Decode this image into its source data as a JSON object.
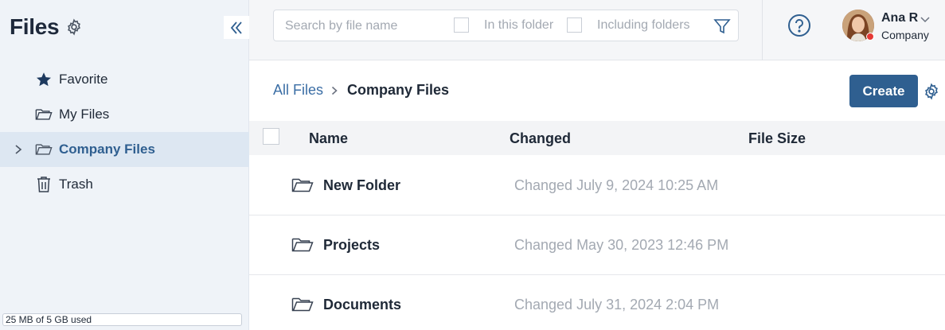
{
  "sidebar": {
    "title": "Files",
    "items": [
      {
        "label": "Favorite",
        "icon": "star-icon",
        "active": false
      },
      {
        "label": "My Files",
        "icon": "folder-icon",
        "active": false
      },
      {
        "label": "Company Files",
        "icon": "folder-icon",
        "active": true
      },
      {
        "label": "Trash",
        "icon": "trash-icon",
        "active": false
      }
    ],
    "storage_text": "25 MB of 5 GB used"
  },
  "search": {
    "placeholder": "Search by file name",
    "option_in_folder": "In this folder",
    "option_including_folders": "Including folders"
  },
  "user": {
    "name": "Ana R",
    "company": "Company",
    "status_color": "#e53935"
  },
  "breadcrumb": {
    "root": "All Files",
    "current": "Company Files"
  },
  "actions": {
    "create_label": "Create"
  },
  "table": {
    "columns": [
      "Name",
      "Changed",
      "File Size"
    ],
    "rows": [
      {
        "name": "New Folder",
        "changed": "Changed July 9, 2024 10:25 AM",
        "size": ""
      },
      {
        "name": "Projects",
        "changed": "Changed May 30, 2023 12:46 PM",
        "size": ""
      },
      {
        "name": "Documents",
        "changed": "Changed July 31, 2024 2:04 PM",
        "size": ""
      }
    ]
  },
  "colors": {
    "accent": "#2f5f90",
    "link": "#3b6ea5",
    "sidebar_bg": "#eff3f8",
    "active_bg": "#dde7f2"
  }
}
